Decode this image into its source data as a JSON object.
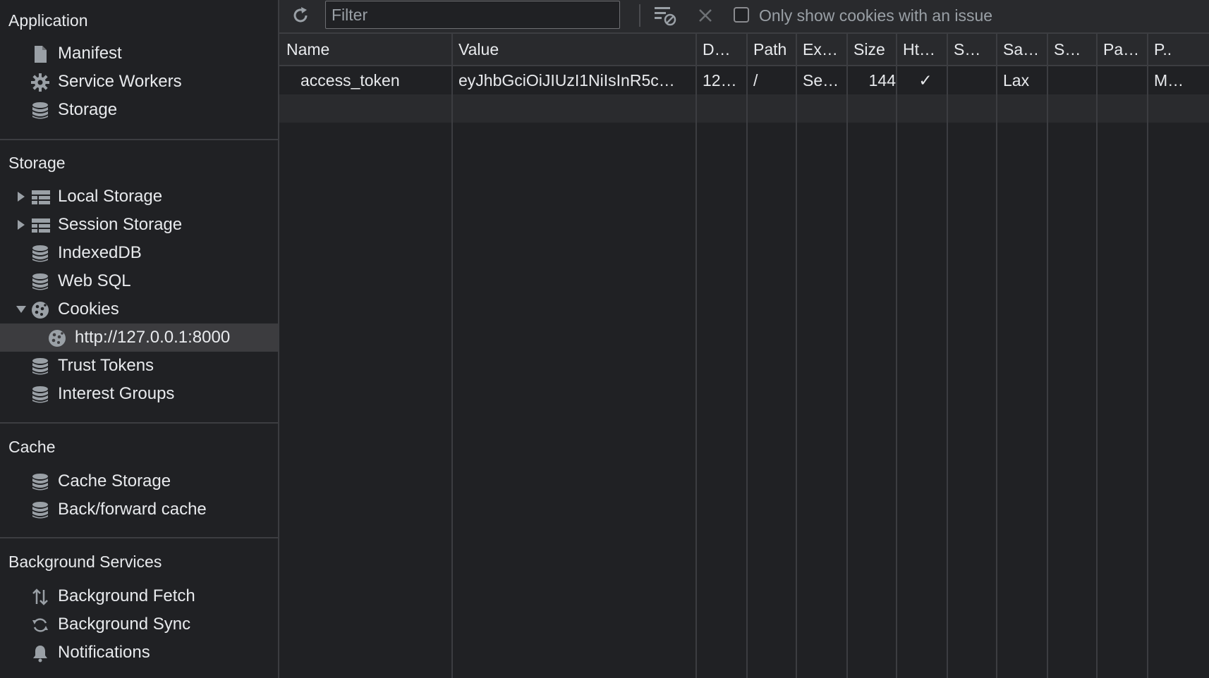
{
  "sidebar": {
    "application": {
      "title": "Application",
      "items": [
        {
          "label": "Manifest",
          "icon": "file-icon"
        },
        {
          "label": "Service Workers",
          "icon": "gear-icon"
        },
        {
          "label": "Storage",
          "icon": "database-icon"
        }
      ]
    },
    "storage": {
      "title": "Storage",
      "items": [
        {
          "label": "Local Storage",
          "icon": "table-icon",
          "expander": "collapsed"
        },
        {
          "label": "Session Storage",
          "icon": "table-icon",
          "expander": "collapsed"
        },
        {
          "label": "IndexedDB",
          "icon": "database-icon"
        },
        {
          "label": "Web SQL",
          "icon": "database-icon"
        },
        {
          "label": "Cookies",
          "icon": "cookie-icon",
          "expander": "expanded"
        },
        {
          "label": "http://127.0.0.1:8000",
          "icon": "cookie-icon",
          "selected": true
        },
        {
          "label": "Trust Tokens",
          "icon": "database-icon"
        },
        {
          "label": "Interest Groups",
          "icon": "database-icon"
        }
      ]
    },
    "cache": {
      "title": "Cache",
      "items": [
        {
          "label": "Cache Storage",
          "icon": "database-icon"
        },
        {
          "label": "Back/forward cache",
          "icon": "database-icon"
        }
      ]
    },
    "background": {
      "title": "Background Services",
      "items": [
        {
          "label": "Background Fetch",
          "icon": "arrows-updown-icon"
        },
        {
          "label": "Background Sync",
          "icon": "sync-icon"
        },
        {
          "label": "Notifications",
          "icon": "bell-icon"
        }
      ]
    }
  },
  "toolbar": {
    "filter_placeholder": "Filter",
    "filter_value": "",
    "only_issues_label": "Only show cookies with an issue",
    "only_issues_checked": false
  },
  "table": {
    "columns": [
      "Name",
      "Value",
      "D…",
      "Path",
      "Ex…",
      "Size",
      "Ht…",
      "S…",
      "Sa…",
      "S…",
      "Pa…",
      "P.."
    ],
    "rows": [
      [
        "access_token",
        "eyJhbGciOiJIUzI1NiIsInR5c…",
        "12…",
        "/",
        "Se…",
        "144",
        "✓",
        "",
        "Lax",
        "",
        "",
        "M…"
      ]
    ]
  },
  "colors": {
    "background": "#202124",
    "toolbar": "#292a2d",
    "selected": "#3c3c3f",
    "border": "#3c3d41",
    "text": "#e8eaed",
    "muted": "#9aa0a6"
  }
}
